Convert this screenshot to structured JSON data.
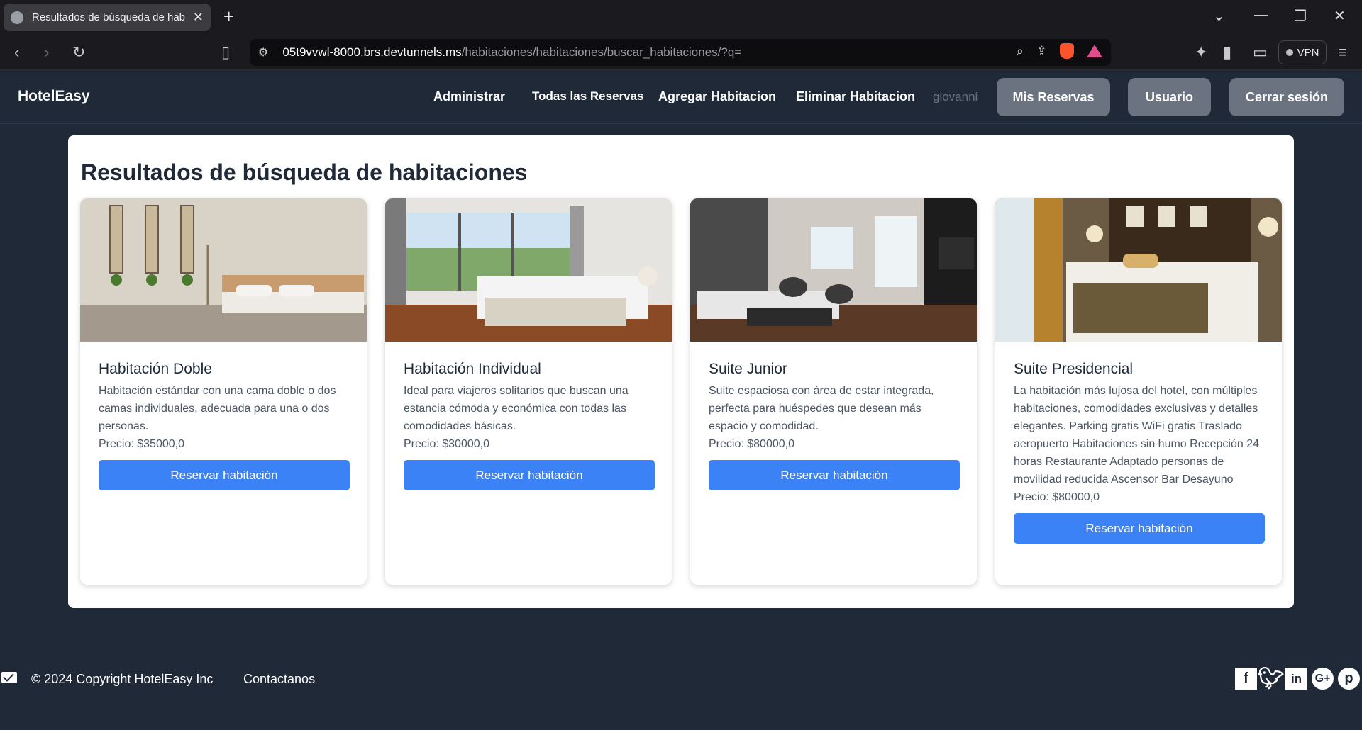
{
  "browser": {
    "tab_title": "Resultados de búsqueda de hab",
    "url_host": "05t9vvwl-8000.brs.devtunnels.ms",
    "url_path": "/habitaciones/habitaciones/buscar_habitaciones/?q=",
    "vpn_label": "VPN"
  },
  "navbar": {
    "brand": "HotelEasy",
    "links": [
      "Administrar",
      "Todas las Reservas",
      "Agregar Habitacion",
      "Eliminar Habitacion"
    ],
    "username": "giovanni",
    "buttons": [
      "Mis Reservas",
      "Usuario",
      "Cerrar sesión"
    ]
  },
  "main": {
    "heading": "Resultados de búsqueda de habitaciones",
    "rooms": [
      {
        "name": "Habitación Doble",
        "description": "Habitación estándar con una cama doble o dos camas individuales, adecuada para una o dos personas.",
        "price": "Precio: $35000,0",
        "button": "Reservar habitación"
      },
      {
        "name": "Habitación Individual",
        "description": "Ideal para viajeros solitarios que buscan una estancia cómoda y económica con todas las comodidades básicas.",
        "price": "Precio: $30000,0",
        "button": "Reservar habitación"
      },
      {
        "name": "Suite Junior",
        "description": "Suite espaciosa con área de estar integrada, perfecta para huéspedes que desean más espacio y comodidad.",
        "price": "Precio: $80000,0",
        "button": "Reservar habitación"
      },
      {
        "name": "Suite Presidencial",
        "description": "La habitación más lujosa del hotel, con múltiples habitaciones, comodidades exclusivas y detalles elegantes. Parking gratis WiFi gratis Traslado aeropuerto Habitaciones sin humo Recepción 24 horas Restaurante Adaptado personas de movilidad reducida Ascensor Bar Desayuno",
        "price": "Precio: $80000,0",
        "button": "Reservar habitación"
      }
    ]
  },
  "footer": {
    "copyright": "© 2024 Copyright HotelEasy Inc",
    "contact": "Contactanos",
    "social_icons": [
      "facebook-icon",
      "twitter-icon",
      "linkedin-icon",
      "google-plus-icon",
      "pinterest-icon"
    ]
  },
  "colors": {
    "background": "#1f2937",
    "primary_button": "#3b82f6",
    "nav_button": "#6b7280"
  }
}
